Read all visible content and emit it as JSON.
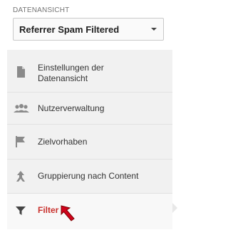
{
  "view_section": {
    "label": "DATENANSICHT",
    "selected_view": "Referrer Spam Filtered"
  },
  "menu": {
    "items": [
      {
        "label": "Einstellungen der Datenansicht",
        "icon": "document-icon"
      },
      {
        "label": "Nutzerverwaltung",
        "icon": "people-icon"
      },
      {
        "label": "Zielvorhaben",
        "icon": "flag-icon"
      },
      {
        "label": "Gruppierung nach Content",
        "icon": "grouping-icon"
      },
      {
        "label": "Filter",
        "icon": "filter-icon",
        "active": true
      }
    ]
  },
  "colors": {
    "active_text": "#c9302c",
    "annotation_arrow": "#d0021b"
  }
}
